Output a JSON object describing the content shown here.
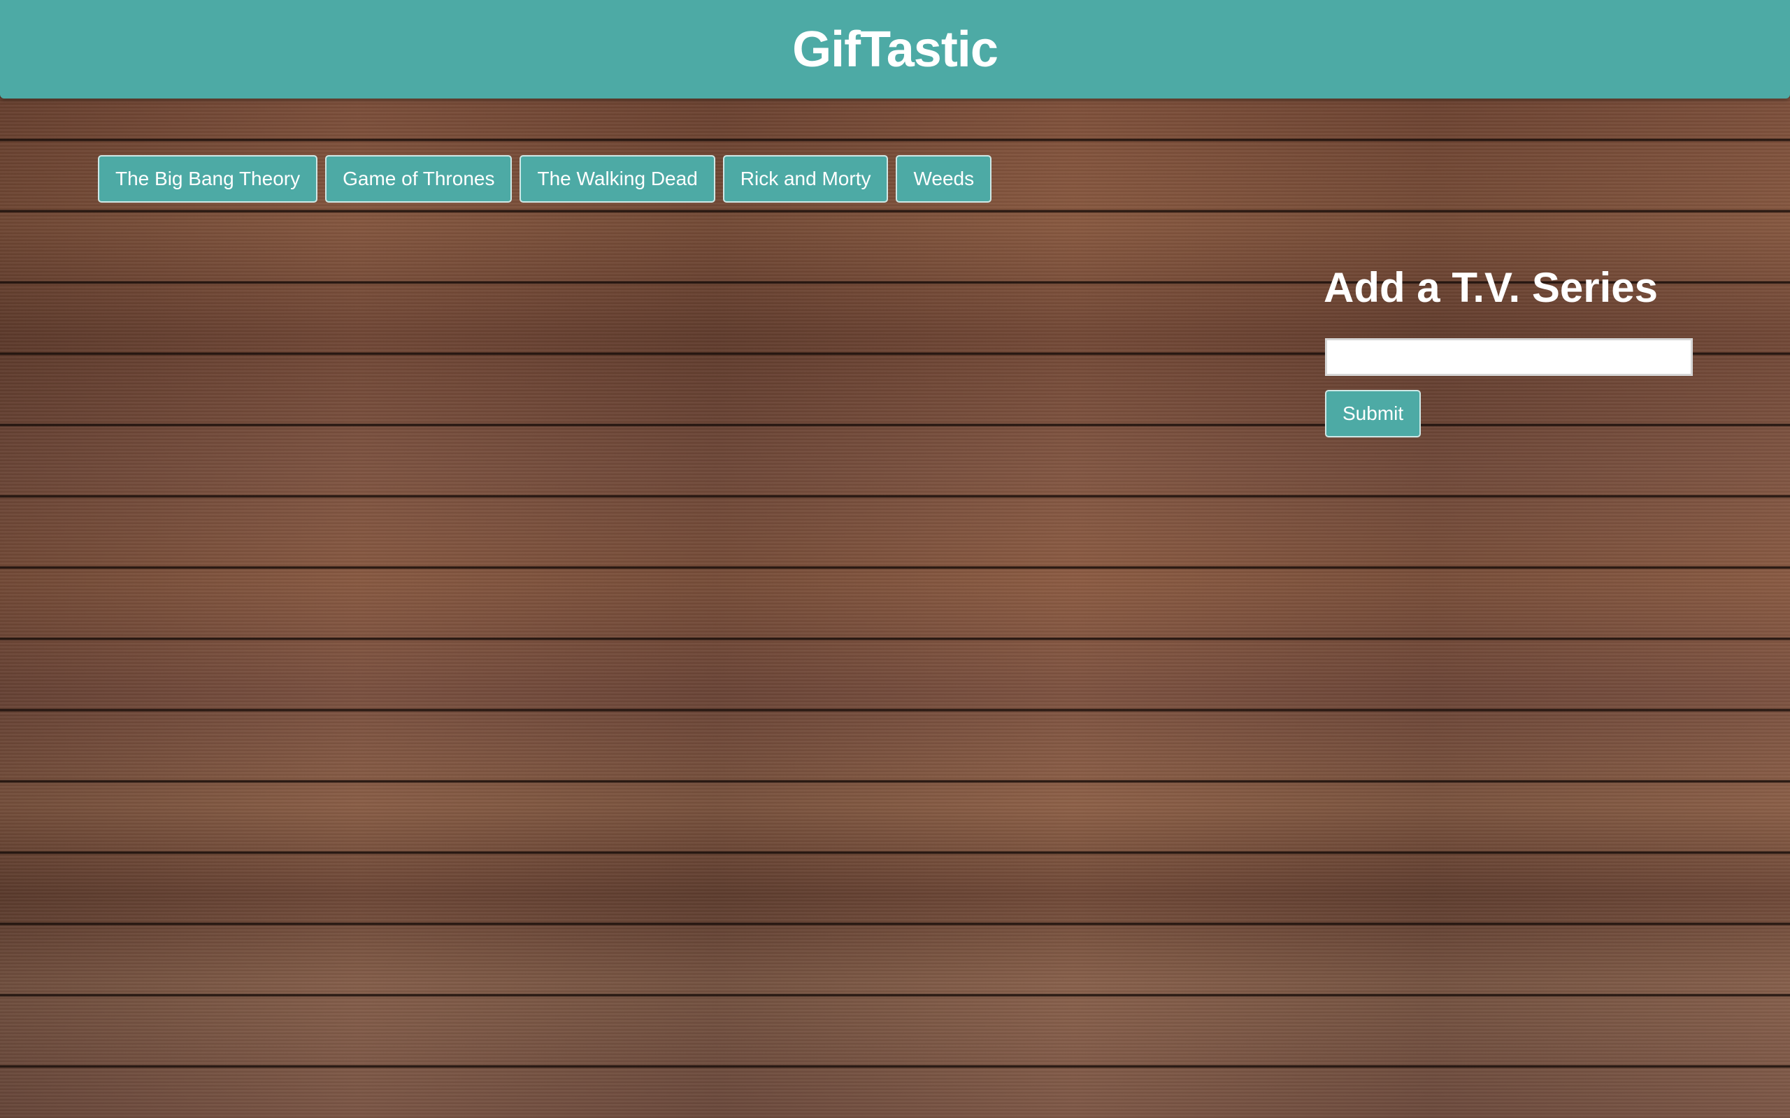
{
  "header": {
    "title": "GifTastic"
  },
  "series_buttons": [
    {
      "label": "The Big Bang Theory"
    },
    {
      "label": "Game of Thrones"
    },
    {
      "label": "The Walking Dead"
    },
    {
      "label": "Rick and Morty"
    },
    {
      "label": "Weeds"
    }
  ],
  "add_form": {
    "heading": "Add a T.V. Series",
    "input_value": "",
    "submit_label": "Submit"
  },
  "colors": {
    "accent": "#4daaa5",
    "text": "#ffffff"
  }
}
